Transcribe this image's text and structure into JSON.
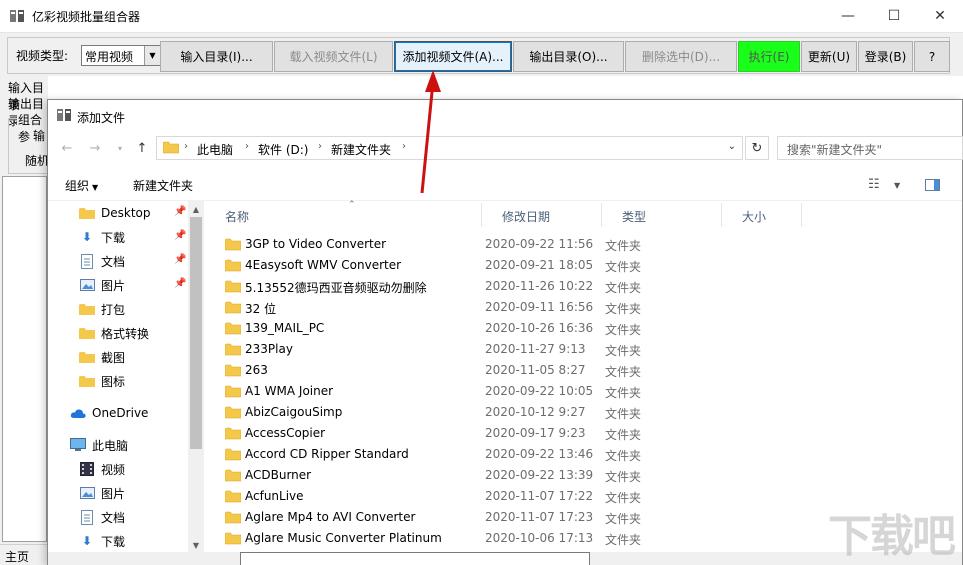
{
  "main_window": {
    "title": "亿彩视频批量组合器",
    "controls": {
      "minimize": "—",
      "maximize": "☐",
      "close": "✕"
    },
    "toolbar": {
      "video_type_label": "视频类型:",
      "video_type_value": "常用视频",
      "buttons": [
        {
          "label": "输入目录(I)...",
          "state": "normal"
        },
        {
          "label": "载入视频文件(L)",
          "state": "disabled"
        },
        {
          "label": "添加视频文件(A)...",
          "state": "focused"
        },
        {
          "label": "输出目录(O)...",
          "state": "normal"
        },
        {
          "label": "删除选中(D)...",
          "state": "disabled"
        },
        {
          "label": "执行(E)",
          "state": "highlighted"
        },
        {
          "label": "更新(U)",
          "state": "normal"
        },
        {
          "label": "登录(B)",
          "state": "normal"
        },
        {
          "label": "?",
          "state": "normal"
        }
      ]
    },
    "left_panel": {
      "input_dir_label": "输入目录",
      "output_dir_label": "输出目录",
      "group_label": "组合参",
      "group_line2": "输",
      "group_line3": "随机"
    },
    "statusbar": "主页"
  },
  "dialog": {
    "title": "添加文件",
    "breadcrumbs": [
      "此电脑",
      "软件 (D:)",
      "新建文件夹"
    ],
    "search_placeholder": "搜索\"新建文件夹\"",
    "commands": {
      "organize": "组织",
      "new_folder": "新建文件夹"
    },
    "nav_items": [
      {
        "label": "Desktop",
        "icon": "folder-icon",
        "pinned": true
      },
      {
        "label": "下载",
        "icon": "download-icon",
        "pinned": true
      },
      {
        "label": "文档",
        "icon": "document-icon",
        "pinned": true
      },
      {
        "label": "图片",
        "icon": "picture-icon",
        "pinned": true
      },
      {
        "label": "打包",
        "icon": "folder-icon",
        "pinned": false
      },
      {
        "label": "格式转换",
        "icon": "folder-icon",
        "pinned": false
      },
      {
        "label": "截图",
        "icon": "folder-icon",
        "pinned": false
      },
      {
        "label": "图标",
        "icon": "folder-icon",
        "pinned": false
      },
      {
        "label": "OneDrive",
        "icon": "cloud-icon",
        "pinned": false
      },
      {
        "label": "此电脑",
        "icon": "computer-icon",
        "pinned": false
      },
      {
        "label": "视频",
        "icon": "video-icon",
        "pinned": false
      },
      {
        "label": "图片",
        "icon": "picture-icon",
        "pinned": false
      },
      {
        "label": "文档",
        "icon": "document-icon",
        "pinned": false
      },
      {
        "label": "下载",
        "icon": "download-icon",
        "pinned": false
      }
    ],
    "columns": [
      "名称",
      "修改日期",
      "类型",
      "大小"
    ],
    "files": [
      {
        "name": "3GP to Video Converter",
        "date": "2020-09-22 11:56",
        "type": "文件夹"
      },
      {
        "name": "4Easysoft WMV Converter",
        "date": "2020-09-21 18:05",
        "type": "文件夹"
      },
      {
        "name": "5.13552德玛西亚音频驱动勿删除",
        "date": "2020-11-26 10:22",
        "type": "文件夹"
      },
      {
        "name": "32 位",
        "date": "2020-09-11 16:56",
        "type": "文件夹"
      },
      {
        "name": "139_MAIL_PC",
        "date": "2020-10-26 16:36",
        "type": "文件夹"
      },
      {
        "name": "233Play",
        "date": "2020-11-27 9:13",
        "type": "文件夹"
      },
      {
        "name": "263",
        "date": "2020-11-05 8:27",
        "type": "文件夹"
      },
      {
        "name": "A1 WMA Joiner",
        "date": "2020-09-22 10:05",
        "type": "文件夹"
      },
      {
        "name": "AbizCaigouSimp",
        "date": "2020-10-12 9:27",
        "type": "文件夹"
      },
      {
        "name": "AccessCopier",
        "date": "2020-09-17 9:23",
        "type": "文件夹"
      },
      {
        "name": "Accord CD Ripper Standard",
        "date": "2020-09-22 13:46",
        "type": "文件夹"
      },
      {
        "name": "ACDBurner",
        "date": "2020-09-22 13:39",
        "type": "文件夹"
      },
      {
        "name": "AcfunLive",
        "date": "2020-11-07 17:22",
        "type": "文件夹"
      },
      {
        "name": "Aglare Mp4 to AVI Converter",
        "date": "2020-11-07 17:23",
        "type": "文件夹"
      },
      {
        "name": "Aglare Music Converter Platinum",
        "date": "2020-10-06 17:13",
        "type": "文件夹"
      }
    ]
  },
  "colors": {
    "execute_green": "#1aff1a",
    "annotation_arrow": "#cc1111",
    "folder_yellow": "#f4c84a"
  },
  "watermark": "下载吧"
}
